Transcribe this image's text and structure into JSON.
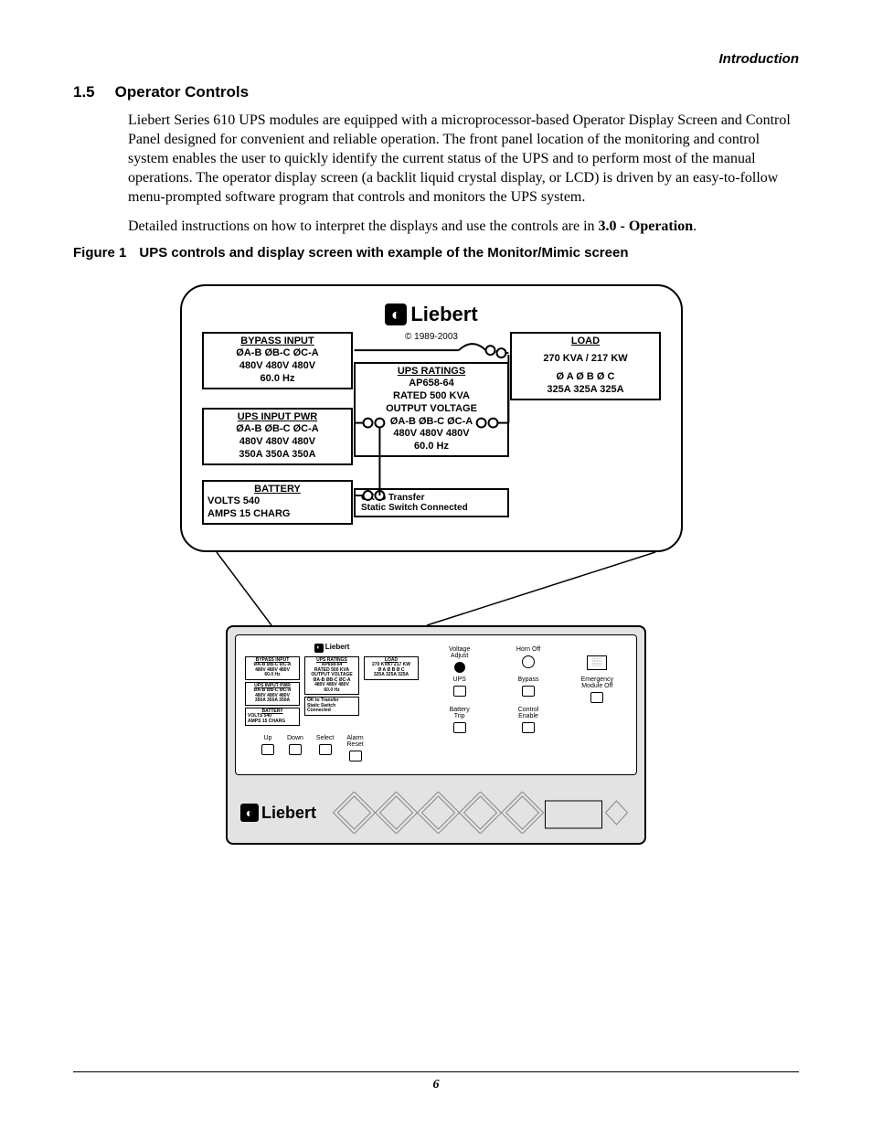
{
  "running_head": "Introduction",
  "section": {
    "number": "1.5",
    "title": "Operator Controls"
  },
  "para1": "Liebert Series 610 UPS modules are equipped with a microprocessor-based Operator Display Screen and Control Panel designed for convenient and reliable operation. The front panel location of the monitoring and control system enables the user to quickly identify the current status of the UPS and to perform most of the manual operations. The operator display screen (a backlit liquid crystal display, or LCD) is driven by an easy-to-follow menu-prompted software program that controls and monitors the UPS system.",
  "para2_pre": "Detailed instructions on how to interpret the displays and use the controls are in ",
  "para2_bold": "3.0 - Operation",
  "para2_post": ".",
  "figure": {
    "label": "Figure 1",
    "caption": "UPS controls and display screen with example of the Monitor/Mimic screen"
  },
  "brand": "Liebert",
  "copyright": "© 1989-2003",
  "bypass": {
    "title": "BYPASS INPUT",
    "phases": "ØA-B  ØB-C  ØC-A",
    "volts": "480V  480V  480V",
    "freq": "60.0 Hz"
  },
  "ups_input": {
    "title": "UPS INPUT PWR",
    "phases": "ØA-B  ØB-C  ØC-A",
    "volts": "480V  480V  480V",
    "amps": "350A  350A  350A"
  },
  "battery": {
    "title": "BATTERY",
    "volts": "VOLTS 540",
    "amps": "AMPS 15 CHARG"
  },
  "ratings": {
    "title": "UPS RATINGS",
    "model": "AP658-64",
    "rated": "RATED 500 KVA",
    "out": "OUTPUT VOLTAGE",
    "phases": "ØA-B  ØB-C  ØC-A",
    "volts": "480V  480V  480V",
    "freq": "60.0 Hz"
  },
  "load": {
    "title": "LOAD",
    "kva": "270 KVA / 217 KW",
    "phases": "Ø A     Ø B     Ø C",
    "amps": "325A  325A  325A"
  },
  "status": {
    "l1": "OK to Transfer",
    "l2": "Static Switch Connected"
  },
  "panel": {
    "buttons": {
      "up": "Up",
      "down": "Down",
      "select": "Select",
      "alarm_reset": "Alarm\nReset",
      "voltage_adjust": "Voltage\nAdjust",
      "horn_off": "Horn Off",
      "ups": "UPS",
      "bypass": "Bypass",
      "emerg_off": "Emergency\nModule Off",
      "batt_trip": "Battery\nTrip",
      "ctrl_enable": "Control\nEnable"
    }
  },
  "page_number": "6"
}
